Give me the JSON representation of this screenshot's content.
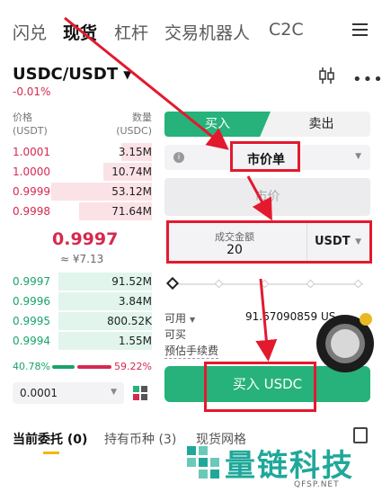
{
  "topnav": {
    "tabs": [
      "闪兑",
      "现货",
      "杠杆",
      "交易机器人",
      "C2C"
    ],
    "active_index": 1,
    "menu_icon": "hamburger-menu-icon"
  },
  "pair": {
    "symbol": "USDC/USDT",
    "change": "-0.01%"
  },
  "orderbook": {
    "price_header": [
      "价格",
      "(USDT)"
    ],
    "qty_header": [
      "数量",
      "(USDC)"
    ],
    "asks": [
      {
        "price": "1.0001",
        "qty": "3.15M",
        "depth": 0.22
      },
      {
        "price": "1.0000",
        "qty": "10.74M",
        "depth": 0.35
      },
      {
        "price": "0.9999",
        "qty": "53.12M",
        "depth": 0.72
      },
      {
        "price": "0.9998",
        "qty": "71.64M",
        "depth": 0.52
      }
    ],
    "mid_price": "0.9997",
    "mid_approx": "≈ ¥7.13",
    "bids": [
      {
        "price": "0.9997",
        "qty": "91.52M",
        "depth": 0.67
      },
      {
        "price": "0.9996",
        "qty": "3.84M",
        "depth": 0.67
      },
      {
        "price": "0.9995",
        "qty": "800.52K",
        "depth": 0.67
      },
      {
        "price": "0.9994",
        "qty": "1.55M",
        "depth": 0.67
      }
    ],
    "buy_ratio": "40.78%",
    "sell_ratio": "59.22%",
    "depth_value": "0.0001"
  },
  "form": {
    "buy_tab": "买入",
    "sell_tab": "卖出",
    "order_type": "市价单",
    "price_placeholder": "市价",
    "amount_label": "成交金额",
    "amount_value": "20",
    "amount_unit": "USDT",
    "slider_value": 0,
    "available_label": "可用",
    "available_value": "91.67090859 US",
    "can_buy_label": "可买",
    "fee_label": "预估手续费",
    "buy_button": "买入 USDC"
  },
  "bottom_tabs": {
    "tabs": [
      "当前委托 (0)",
      "持有币种 (3)",
      "现货网格"
    ]
  },
  "watermark": {
    "text": "量链科技",
    "url": "QFSP.NET"
  },
  "colors": {
    "buy": "#26b27a",
    "sell": "#d6294f",
    "annotation": "#e3192e",
    "watermark": "#1fa89a"
  }
}
